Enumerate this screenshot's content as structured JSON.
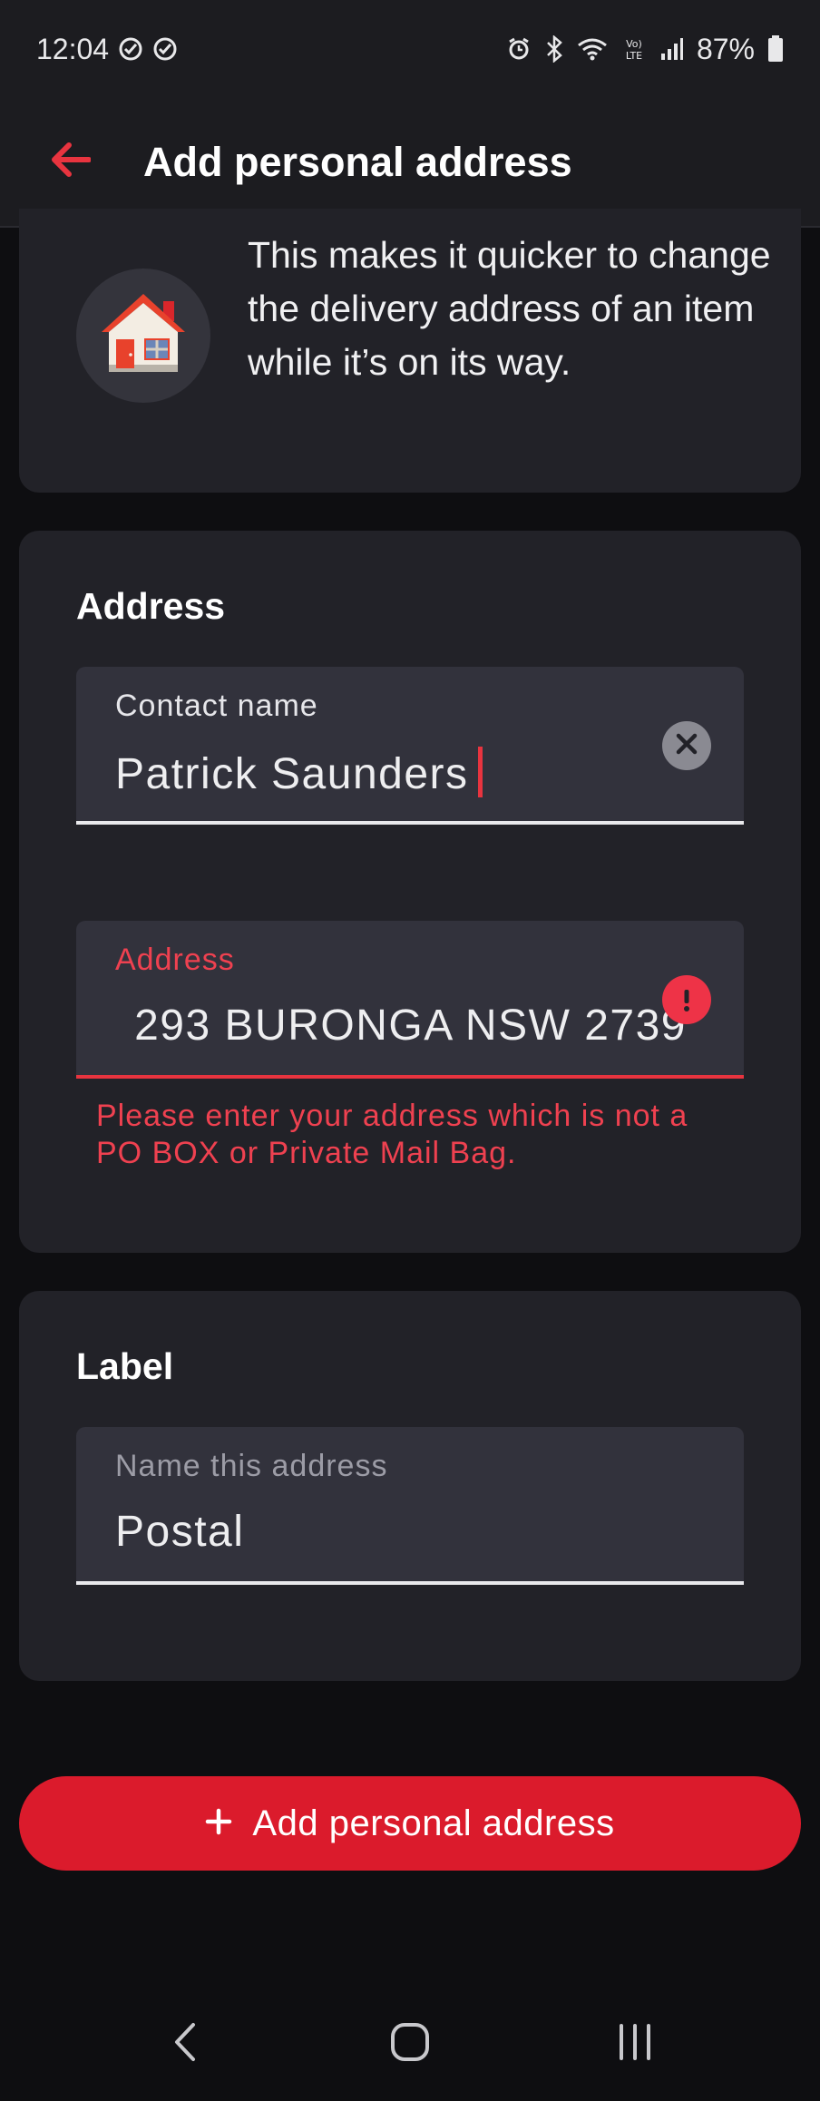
{
  "status_bar": {
    "time": "12:04",
    "battery": "87%",
    "icons": [
      "check-circle-icon",
      "check-circle-icon",
      "alarm-icon",
      "bluetooth-icon",
      "wifi-icon",
      "volte-icon",
      "signal-icon",
      "battery-icon"
    ]
  },
  "app_bar": {
    "title": "Add personal address",
    "back_icon": "arrow-left-icon"
  },
  "info": {
    "text": "This makes it quicker to change the delivery address of an item while it’s on its way.",
    "icon": "house-icon"
  },
  "address_section": {
    "heading": "Address",
    "contact_field": {
      "label": "Contact name",
      "value": "Patrick Saunders"
    },
    "address_field": {
      "label": "Address",
      "value": "293 BURONGA NSW 2739",
      "error": "Please enter your address which is not a PO BOX or Private Mail Bag."
    }
  },
  "label_section": {
    "heading": "Label",
    "name_field": {
      "label": "Name this address",
      "value": "Postal"
    }
  },
  "primary_button": {
    "label": "Add personal address",
    "icon": "plus-icon"
  },
  "nav": {
    "back_icon": "nav-back-icon",
    "home_icon": "nav-home-icon",
    "recents_icon": "nav-recents-icon"
  },
  "colors": {
    "accent": "#db1b2c",
    "error": "#ef4150",
    "background": "#0e0e11",
    "card": "#222228"
  }
}
